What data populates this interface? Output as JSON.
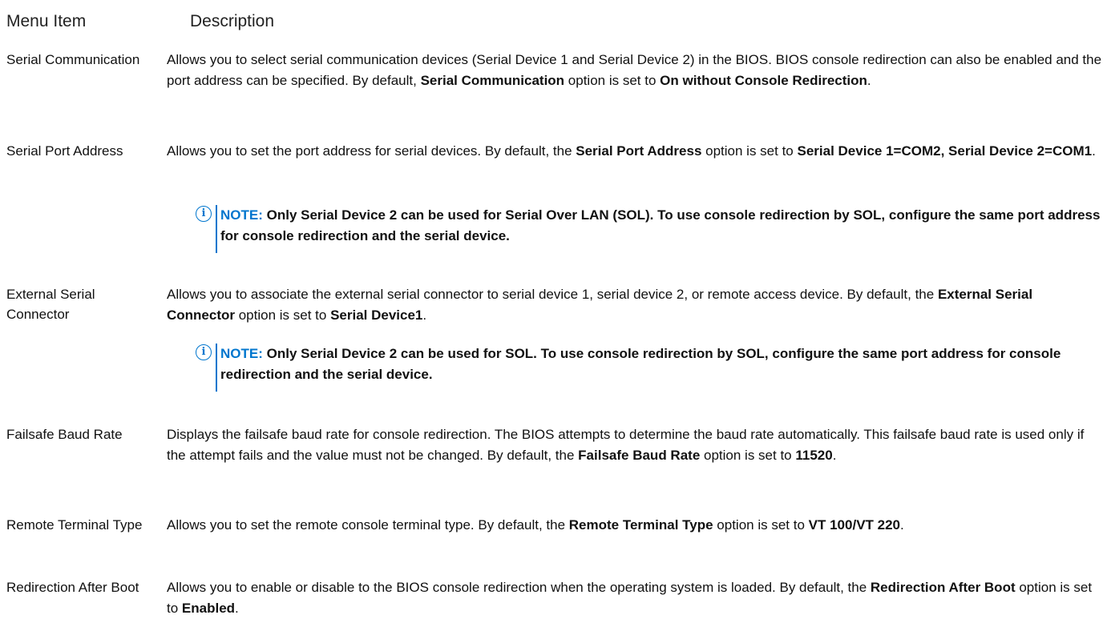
{
  "header": {
    "menu_item": "Menu Item",
    "description": "Description"
  },
  "rows": {
    "serial_communication": {
      "label": "Serial Communication",
      "d0": "Allows you to select serial communication devices (Serial Device 1 and Serial Device 2) in the BIOS. BIOS console redirection can also be enabled and the port address can be specified. By default, ",
      "b1": "Serial Communication",
      "d2": " option is set to ",
      "b3": "On without Console Redirection",
      "d4": "."
    },
    "serial_port_address": {
      "label": "Serial Port Address",
      "d0": "Allows you to set the port address for serial devices. By default, the ",
      "b1": "Serial Port Address",
      "d2": " option is set to ",
      "b3": "Serial Device 1=COM2, Serial Device 2=COM1",
      "d4": ".",
      "note_label": "NOTE:",
      "note_text": " Only Serial Device 2 can be used for Serial Over LAN (SOL). To use console redirection by SOL, configure the same port address for console redirection and the serial device."
    },
    "external_serial_connector": {
      "label": "External Serial Connector",
      "d0": "Allows you to associate the external serial connector to serial device 1, serial device 2, or remote access device. By default, the ",
      "b1": "External Serial Connector",
      "d2": " option is set to ",
      "b3": "Serial Device1",
      "d4": ".",
      "note_label": "NOTE:",
      "note_text": " Only Serial Device 2 can be used for SOL. To use console redirection by SOL, configure the same port address for console redirection and the serial device."
    },
    "failsafe_baud_rate": {
      "label": "Failsafe Baud Rate",
      "d0": "Displays the failsafe baud rate for console redirection. The BIOS attempts to determine the baud rate automatically. This failsafe baud rate is used only if the attempt fails and the value must not be changed. By default, the ",
      "b1": "Failsafe Baud Rate",
      "d2": " option is set to ",
      "b3": "11520",
      "d4": "."
    },
    "remote_terminal_type": {
      "label": "Remote Terminal Type",
      "d0": "Allows you to set the remote console terminal type. By default, the ",
      "b1": "Remote Terminal Type",
      "d2": " option is set to ",
      "b3": "VT 100/VT 220",
      "d4": "."
    },
    "redirection_after_boot": {
      "label": "Redirection After Boot",
      "d0": "Allows you to enable or disable to the BIOS console redirection when the operating system is loaded. By default, the ",
      "b1": "Redirection After Boot",
      "d2": " option is set to ",
      "b3": "Enabled",
      "d4": "."
    }
  },
  "colors": {
    "accent": "#0076ce",
    "text": "#111111"
  },
  "icons": {
    "note": "info-icon"
  }
}
